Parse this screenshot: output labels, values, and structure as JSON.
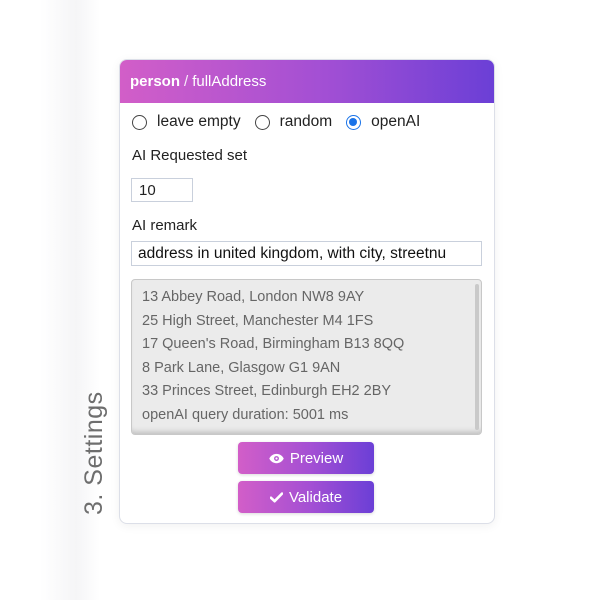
{
  "section": {
    "label": "3. Settings"
  },
  "header": {
    "entity": "person",
    "separator": "/",
    "field": "fullAddress"
  },
  "mode": {
    "options": [
      {
        "label": "leave empty",
        "checked": false
      },
      {
        "label": "random",
        "checked": false
      },
      {
        "label": "openAI",
        "checked": true
      }
    ]
  },
  "requested_set": {
    "label": "AI Requested set",
    "value": "10"
  },
  "remark": {
    "label": "AI remark",
    "value": "address in united kingdom, with city, streetnu"
  },
  "results": {
    "lines": [
      "13 Abbey Road, London NW8 9AY",
      "25 High Street, Manchester M4 1FS",
      "17 Queen's Road, Birmingham B13 8QQ",
      "8 Park Lane, Glasgow G1 9AN",
      "33 Princes Street, Edinburgh EH2 2BY",
      "openAI query duration: 5001 ms"
    ]
  },
  "buttons": {
    "preview": {
      "label": "Preview",
      "icon": "eye-icon"
    },
    "validate": {
      "label": "Validate",
      "icon": "check-icon"
    }
  },
  "colors": {
    "gradient_start": "#d25ec8",
    "gradient_end": "#6b3fd6",
    "radio_accent": "#1a73e8"
  }
}
